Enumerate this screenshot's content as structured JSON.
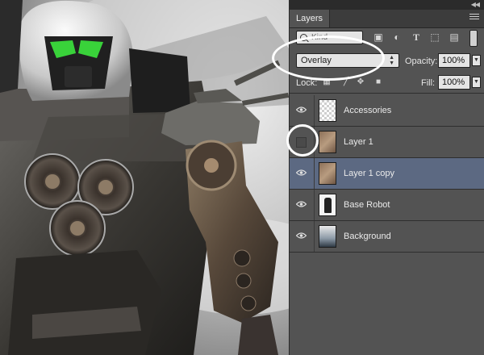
{
  "panel": {
    "tab_label": "Layers",
    "filter": {
      "value": "Kind",
      "icons": [
        "image-filter-icon",
        "adjustment-filter-icon",
        "type-filter-icon",
        "shape-filter-icon",
        "smart-object-filter-icon"
      ]
    },
    "blend_mode": "Overlay",
    "opacity_label": "Opacity:",
    "opacity_value": "100%",
    "lock_label": "Lock:",
    "lock_icons": [
      "lock-transparent-icon",
      "lock-image-icon",
      "lock-position-icon",
      "lock-all-icon"
    ],
    "fill_label": "Fill:",
    "fill_value": "100%"
  },
  "layers": [
    {
      "name": "Accessories",
      "visible": true,
      "selected": false,
      "thumb": "checker"
    },
    {
      "name": "Layer 1",
      "visible": false,
      "selected": false,
      "thumb": "sepia"
    },
    {
      "name": "Layer 1 copy",
      "visible": true,
      "selected": true,
      "thumb": "sepia"
    },
    {
      "name": "Base Robot",
      "visible": true,
      "selected": false,
      "thumb": "robot"
    },
    {
      "name": "Background",
      "visible": true,
      "selected": false,
      "thumb": "bg"
    }
  ],
  "colors": {
    "panel_bg": "#535353",
    "selected_row": "#5c6982",
    "annotation": "#ffffff",
    "visor_green": "#39d23a"
  }
}
